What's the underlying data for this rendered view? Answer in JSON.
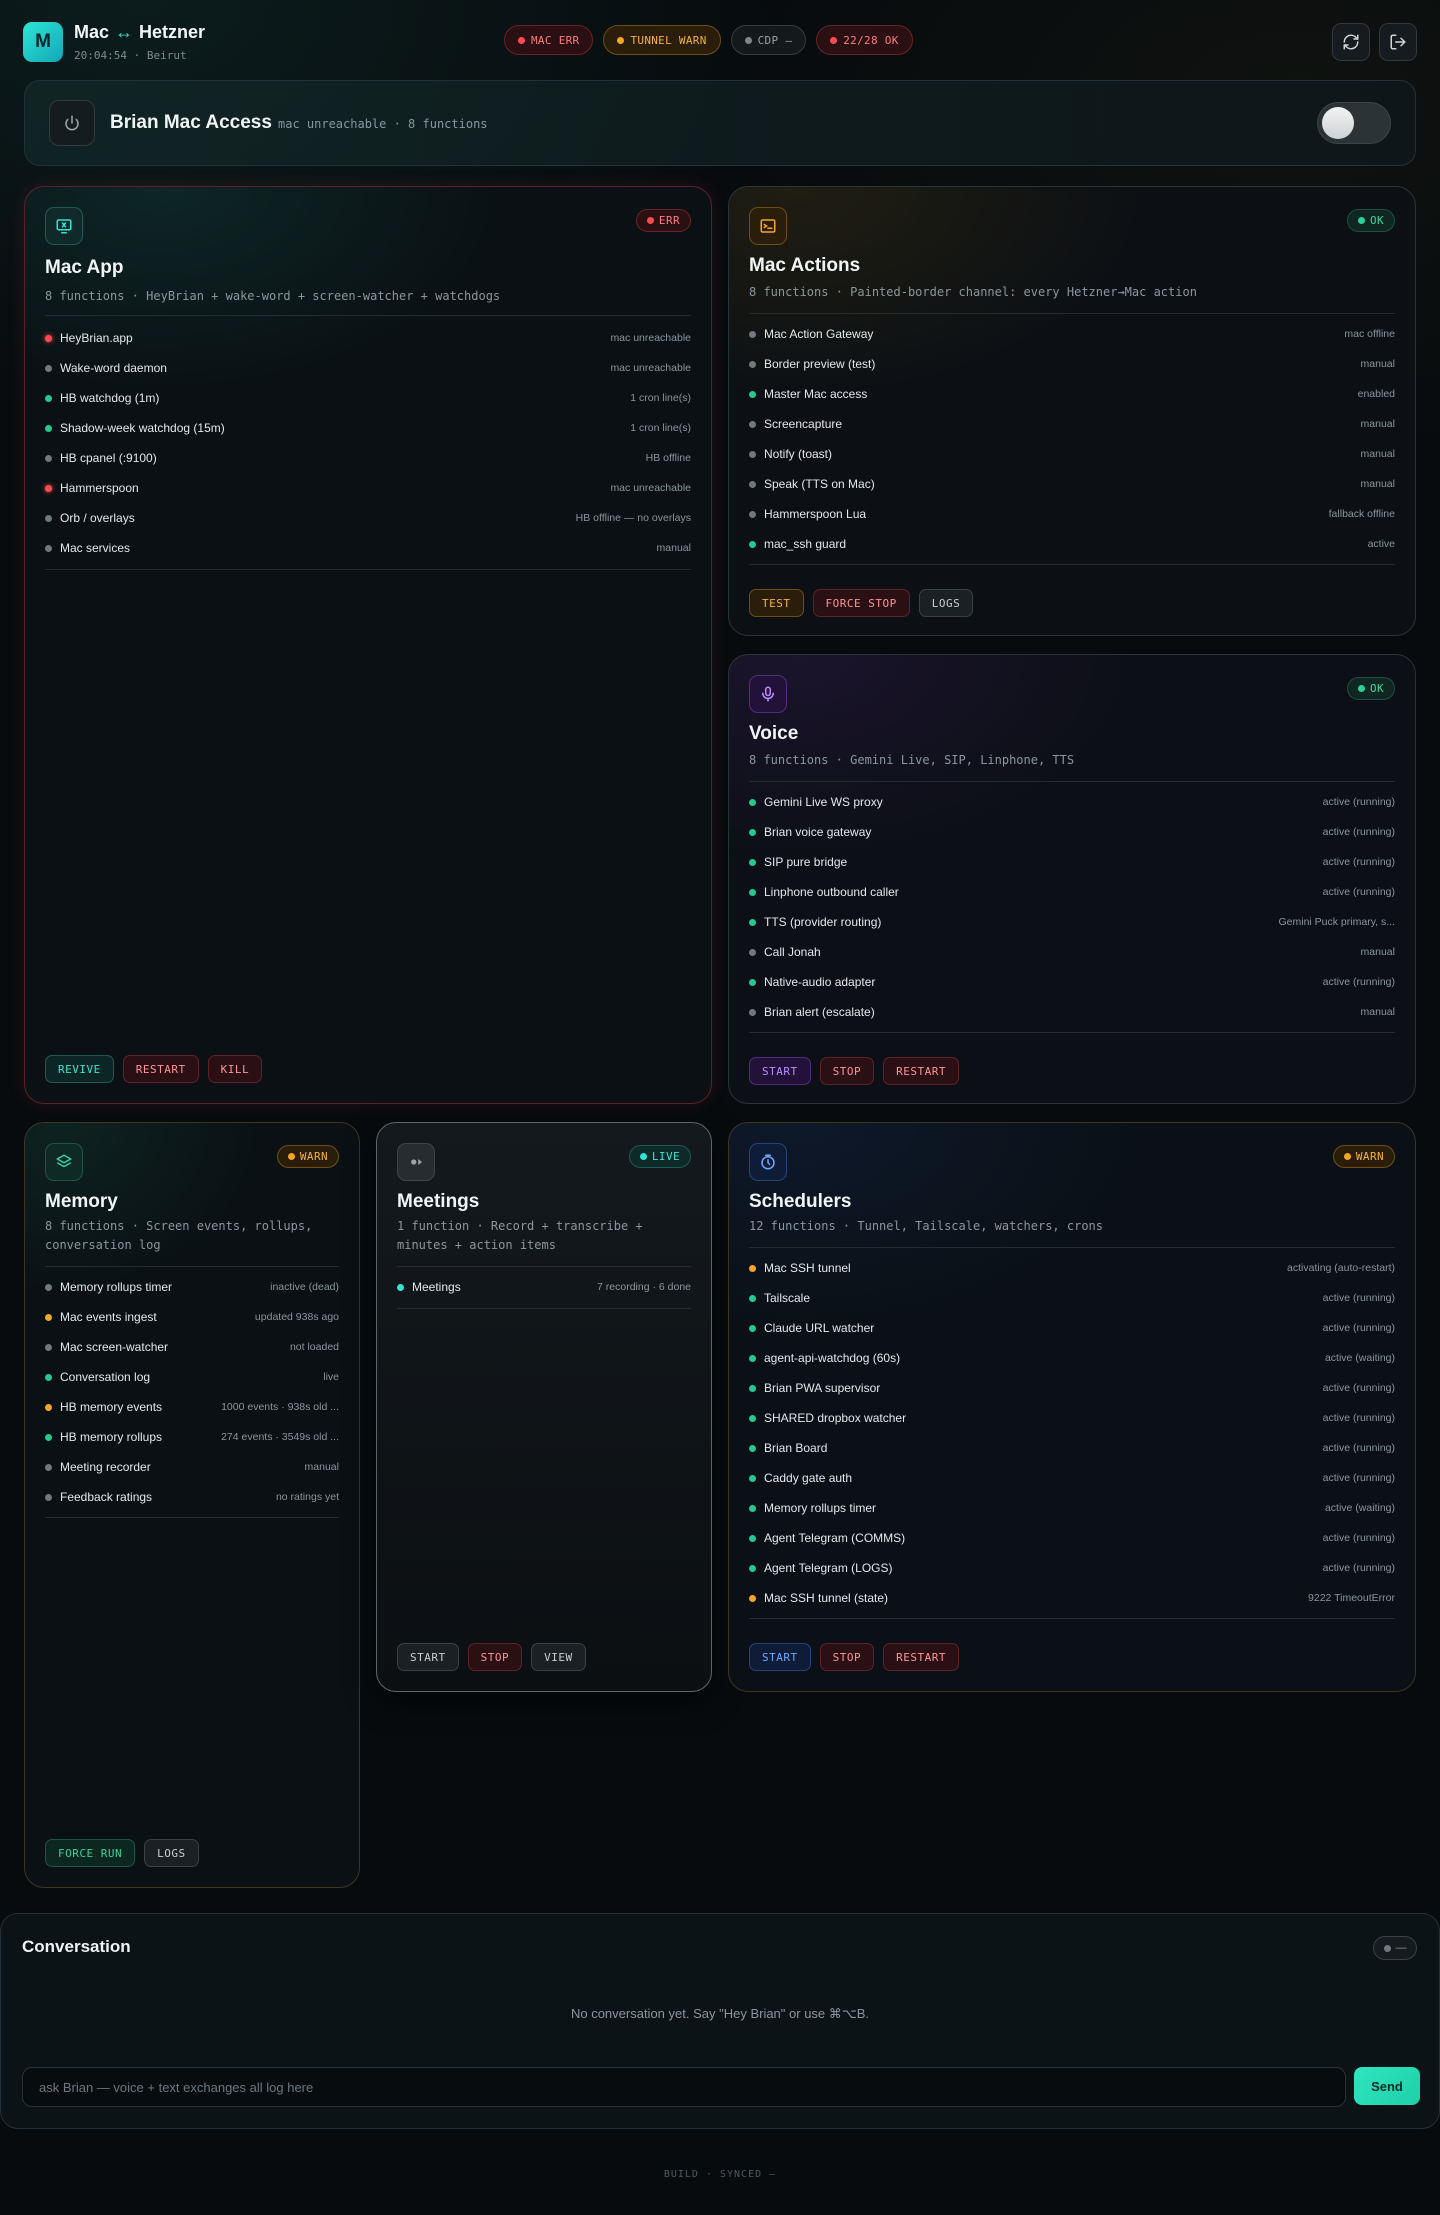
{
  "header": {
    "logo_letter": "M",
    "title_left": "Mac",
    "title_arrow": "↔",
    "title_right": "Hetzner",
    "subtitle": "20:04:54 · Beirut",
    "pills": [
      {
        "label": "MAC ERR",
        "status": "err"
      },
      {
        "label": "TUNNEL WARN",
        "status": "warn"
      },
      {
        "label": "CDP —",
        "status": "neutral"
      },
      {
        "label": "22/28 OK",
        "status": "err"
      }
    ],
    "refresh_icon": "refresh-icon",
    "logout_icon": "logout-icon"
  },
  "access": {
    "title": "Brian Mac Access",
    "subtitle": "mac unreachable · 8 functions",
    "toggle_on": false
  },
  "cards": {
    "mac_app": {
      "title": "Mac App",
      "desc": "8 functions · HeyBrian + wake-word + screen-watcher + watchdogs",
      "badge": "ERR",
      "rows": [
        {
          "name": "HeyBrian.app",
          "status": "mac unreachable",
          "dot": "red"
        },
        {
          "name": "Wake-word daemon",
          "status": "mac unreachable",
          "dot": "grey"
        },
        {
          "name": "HB watchdog (1m)",
          "status": "1 cron line(s)",
          "dot": "green"
        },
        {
          "name": "Shadow-week watchdog (15m)",
          "status": "1 cron line(s)",
          "dot": "green"
        },
        {
          "name": "HB cpanel (:9100)",
          "status": "HB offline",
          "dot": "grey"
        },
        {
          "name": "Hammerspoon",
          "status": "mac unreachable",
          "dot": "red"
        },
        {
          "name": "Orb / overlays",
          "status": "HB offline — no overlays",
          "dot": "grey"
        },
        {
          "name": "Mac services",
          "status": "manual",
          "dot": "grey"
        }
      ],
      "actions": [
        "REVIVE",
        "RESTART",
        "KILL"
      ]
    },
    "mac_actions": {
      "title": "Mac Actions",
      "desc": "8 functions · Painted-border channel: every Hetzner→Mac action",
      "badge": "OK",
      "rows": [
        {
          "name": "Mac Action Gateway",
          "status": "mac offline",
          "dot": "grey"
        },
        {
          "name": "Border preview (test)",
          "status": "manual",
          "dot": "grey"
        },
        {
          "name": "Master Mac access",
          "status": "enabled",
          "dot": "green"
        },
        {
          "name": "Screencapture",
          "status": "manual",
          "dot": "grey"
        },
        {
          "name": "Notify (toast)",
          "status": "manual",
          "dot": "grey"
        },
        {
          "name": "Speak (TTS on Mac)",
          "status": "manual",
          "dot": "grey"
        },
        {
          "name": "Hammerspoon Lua",
          "status": "fallback offline",
          "dot": "grey"
        },
        {
          "name": "mac_ssh guard",
          "status": "active",
          "dot": "green"
        }
      ],
      "actions": [
        "TEST",
        "FORCE STOP",
        "LOGS"
      ]
    },
    "voice": {
      "title": "Voice",
      "desc": "8 functions · Gemini Live, SIP, Linphone, TTS",
      "badge": "OK",
      "rows": [
        {
          "name": "Gemini Live WS proxy",
          "status": "active (running)",
          "dot": "green"
        },
        {
          "name": "Brian voice gateway",
          "status": "active (running)",
          "dot": "green"
        },
        {
          "name": "SIP pure bridge",
          "status": "active (running)",
          "dot": "green"
        },
        {
          "name": "Linphone outbound caller",
          "status": "active (running)",
          "dot": "green"
        },
        {
          "name": "TTS (provider routing)",
          "status": "Gemini Puck primary, s...",
          "dot": "green"
        },
        {
          "name": "Call Jonah",
          "status": "manual",
          "dot": "grey"
        },
        {
          "name": "Native-audio adapter",
          "status": "active (running)",
          "dot": "green"
        },
        {
          "name": "Brian alert (escalate)",
          "status": "manual",
          "dot": "grey"
        }
      ],
      "actions": [
        "START",
        "STOP",
        "RESTART"
      ]
    },
    "memory": {
      "title": "Memory",
      "desc": "8 functions · Screen events, rollups, conversation log",
      "badge": "WARN",
      "rows": [
        {
          "name": "Memory rollups timer",
          "status": "inactive (dead)",
          "dot": "grey"
        },
        {
          "name": "Mac events ingest",
          "status": "updated 938s ago",
          "dot": "amber"
        },
        {
          "name": "Mac screen-watcher",
          "status": "not loaded",
          "dot": "grey"
        },
        {
          "name": "Conversation log",
          "status": "live",
          "dot": "green"
        },
        {
          "name": "HB memory events",
          "status": "1000 events · 938s old ...",
          "dot": "amber"
        },
        {
          "name": "HB memory rollups",
          "status": "274 events · 3549s old ...",
          "dot": "green"
        },
        {
          "name": "Meeting recorder",
          "status": "manual",
          "dot": "grey"
        },
        {
          "name": "Feedback ratings",
          "status": "no ratings yet",
          "dot": "grey"
        }
      ],
      "actions": [
        "FORCE RUN",
        "LOGS"
      ]
    },
    "meetings": {
      "title": "Meetings",
      "desc": "1 function · Record + transcribe + minutes + action items",
      "badge": "LIVE",
      "rows": [
        {
          "name": "Meetings",
          "status": "7 recording · 6 done",
          "dot": "teal"
        }
      ],
      "actions": [
        "START",
        "STOP",
        "VIEW"
      ]
    },
    "schedulers": {
      "title": "Schedulers",
      "desc": "12 functions · Tunnel, Tailscale, watchers, crons",
      "badge": "WARN",
      "rows": [
        {
          "name": "Mac SSH tunnel",
          "status": "activating (auto-restart)",
          "dot": "amber"
        },
        {
          "name": "Tailscale",
          "status": "active (running)",
          "dot": "green"
        },
        {
          "name": "Claude URL watcher",
          "status": "active (running)",
          "dot": "green"
        },
        {
          "name": "agent-api-watchdog (60s)",
          "status": "active (waiting)",
          "dot": "green"
        },
        {
          "name": "Brian PWA supervisor",
          "status": "active (running)",
          "dot": "green"
        },
        {
          "name": "SHARED dropbox watcher",
          "status": "active (running)",
          "dot": "green"
        },
        {
          "name": "Brian Board",
          "status": "active (running)",
          "dot": "green"
        },
        {
          "name": "Caddy gate auth",
          "status": "active (running)",
          "dot": "green"
        },
        {
          "name": "Memory rollups timer",
          "status": "active (waiting)",
          "dot": "green"
        },
        {
          "name": "Agent Telegram (COMMS)",
          "status": "active (running)",
          "dot": "green"
        },
        {
          "name": "Agent Telegram (LOGS)",
          "status": "active (running)",
          "dot": "green"
        },
        {
          "name": "Mac SSH tunnel (state)",
          "status": "9222 TimeoutError",
          "dot": "amber"
        }
      ],
      "actions": [
        "START",
        "STOP",
        "RESTART"
      ]
    }
  },
  "conversation": {
    "title": "Conversation",
    "pill": "—",
    "empty": "No conversation yet. Say \"Hey Brian\" or use ⌘⌥B.",
    "placeholder": "ask Brian — voice + text exchanges all log here",
    "send_label": "Send"
  },
  "footer": "BUILD · SYNCED —"
}
